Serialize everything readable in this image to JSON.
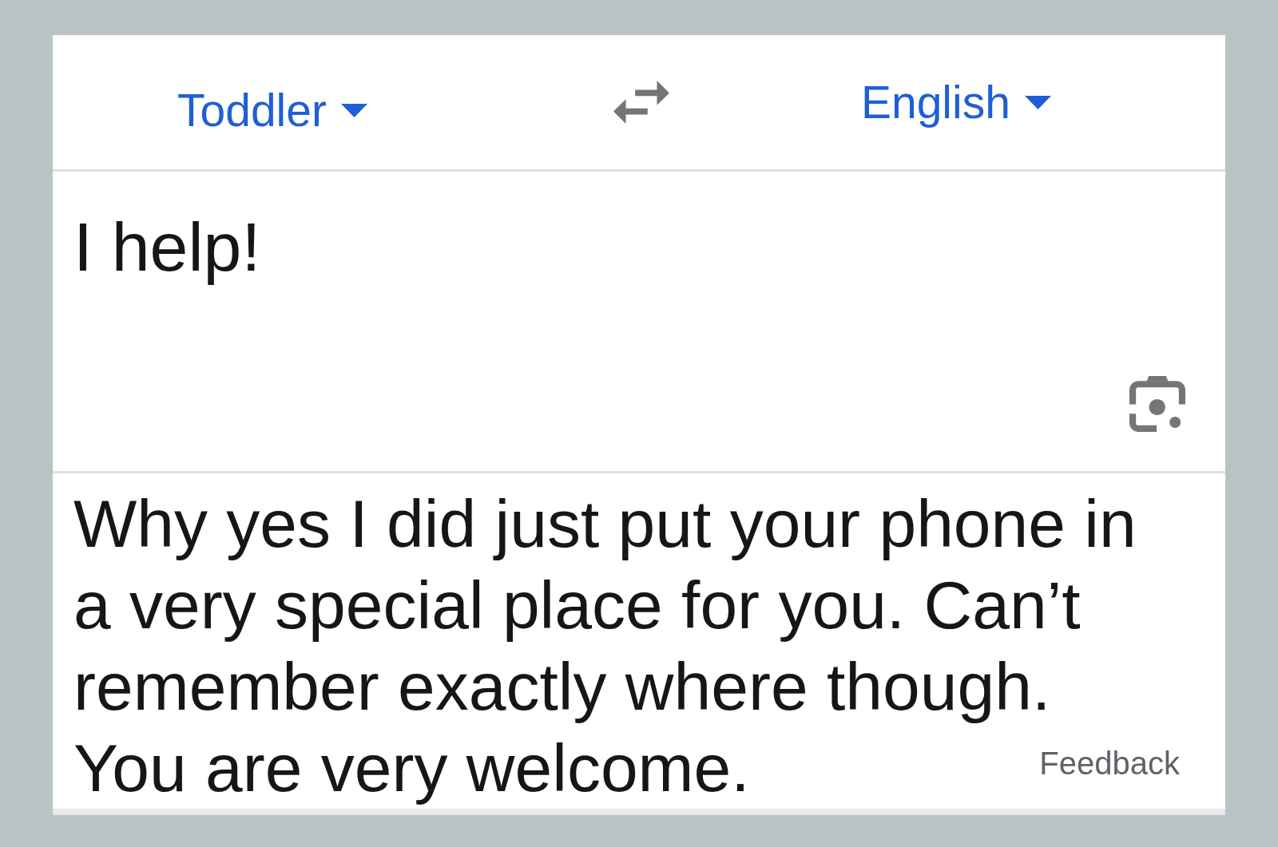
{
  "language_bar": {
    "source_language": "Toddler",
    "target_language": "English"
  },
  "source_text": {
    "value": "I help!"
  },
  "translation": {
    "lines": [
      "Why yes I did just put your phone in",
      "a very special place for you. Can’t",
      "remember exactly where though.",
      "You are very welcome."
    ],
    "feedback_link": "Feedback"
  }
}
